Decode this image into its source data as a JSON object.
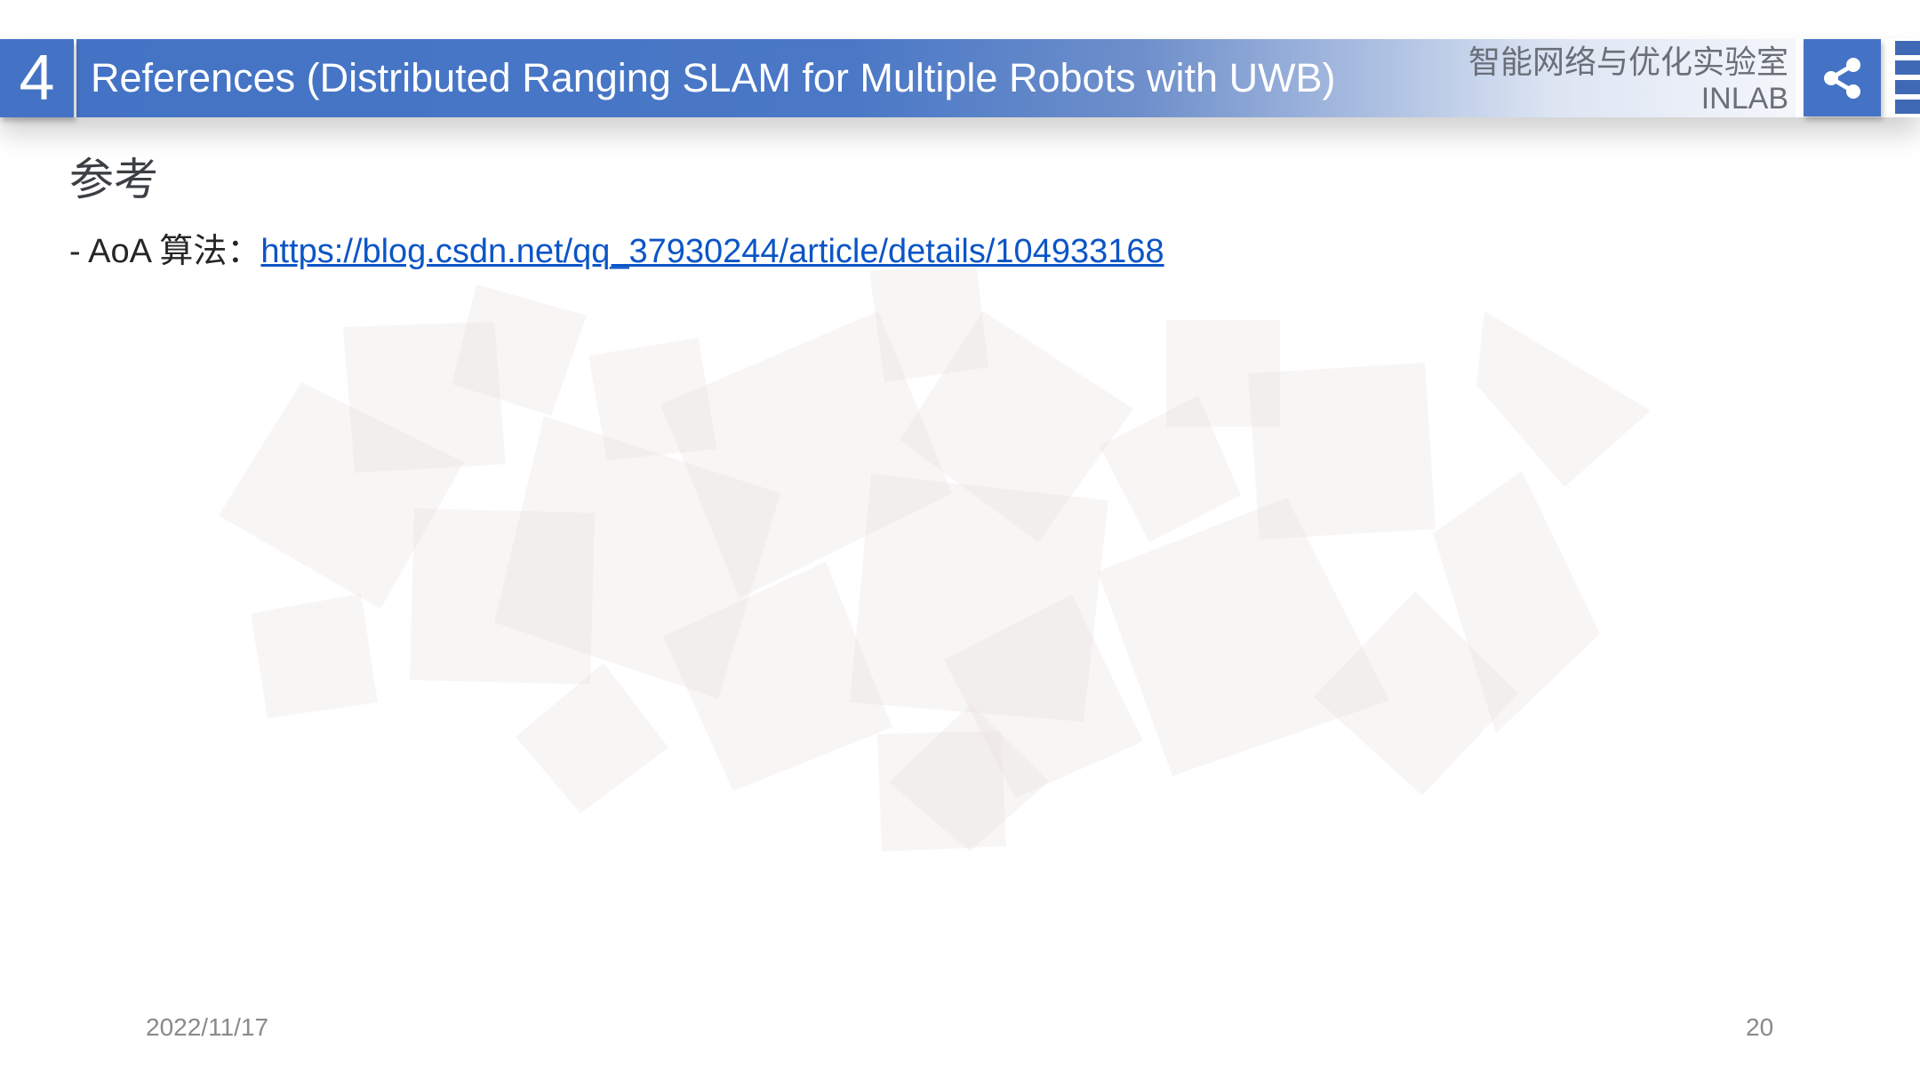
{
  "slide": {
    "section_number": "4",
    "title": "References (Distributed Ranging SLAM for Multiple Robots with UWB)",
    "lab_name": "智能网络与优化实验室",
    "lab_code": "INLAB",
    "share_icon": "share-icon",
    "heading": "参考",
    "reference": {
      "prefix": "- AoA 算法：",
      "link_text": "https://blog.csdn.net/qq_37930244/article/details/104933168"
    },
    "footer": {
      "date": "2022/11/17",
      "page_number": "20"
    }
  },
  "colors": {
    "accent_blue": "#4473c5",
    "link_blue": "#0b55c6",
    "decor_square": "#ece6e6"
  }
}
